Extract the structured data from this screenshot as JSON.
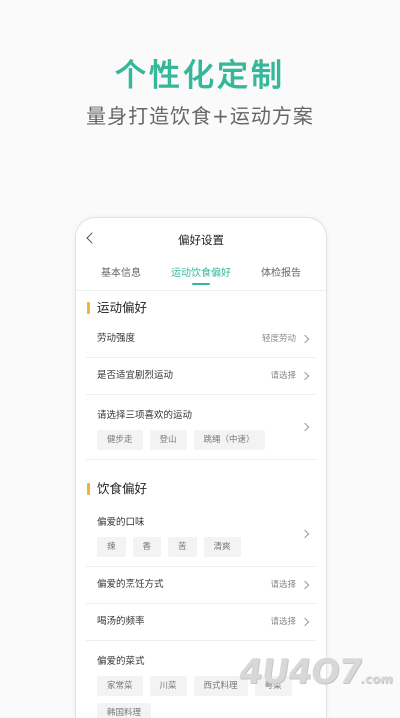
{
  "promo": {
    "headline": "个性化定制",
    "subline": "量身打造饮食+运动方案"
  },
  "screen": {
    "title": "偏好设置",
    "tabs": [
      {
        "label": "基本信息",
        "active": false
      },
      {
        "label": "运动饮食偏好",
        "active": true
      },
      {
        "label": "体检报告",
        "active": false
      }
    ]
  },
  "sport": {
    "title": "运动偏好",
    "intensity_label": "劳动强度",
    "intensity_value": "轻度劳动",
    "strenuous_label": "是否适宜剧烈运动",
    "strenuous_value": "请选择",
    "favorites_label": "请选择三项喜欢的运动",
    "favorites": [
      "健步走",
      "登山",
      "跳绳（中速）"
    ]
  },
  "diet": {
    "title": "饮食偏好",
    "taste_label": "偏爱的口味",
    "tastes": [
      "辣",
      "香",
      "苦",
      "清爽"
    ],
    "cooking_label": "偏爱的烹饪方式",
    "cooking_value": "请选择",
    "soup_label": "喝汤的频率",
    "soup_value": "请选择",
    "cuisine_label": "偏爱的菜式",
    "cuisines": [
      "家常菜",
      "川菜",
      "西式料理",
      "粤菜",
      "韩国料理"
    ]
  },
  "watermark": {
    "text": "4U4O7",
    "suffix": ".com"
  }
}
